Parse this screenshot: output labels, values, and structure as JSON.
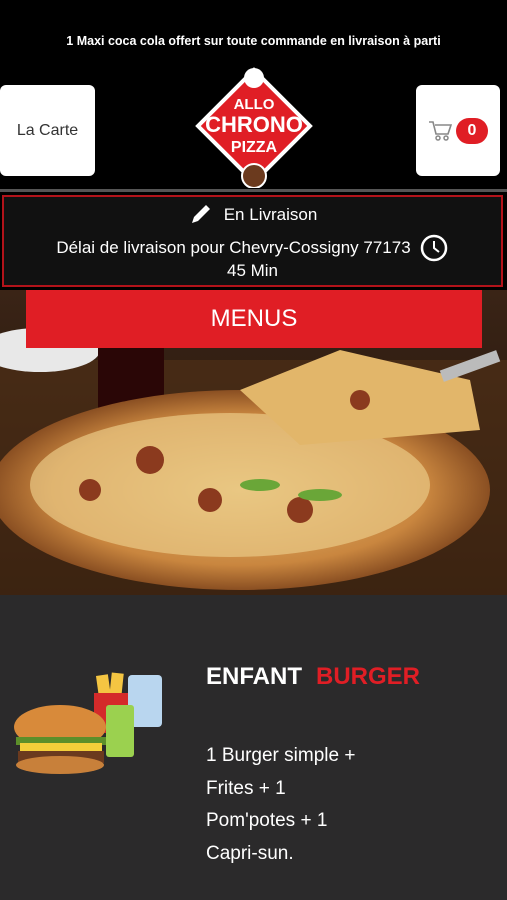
{
  "banner": "1 Maxi coca cola offert sur toute commande en livraison à parti",
  "header": {
    "carte_label": "La Carte",
    "cart_count": "0",
    "logo_line1": "ALLO",
    "logo_line2": "CHRONO",
    "logo_line3": "PIZZA"
  },
  "delivery": {
    "mode": "En Livraison",
    "delay_text": "Délai de livraison pour Chevry-Cossigny 77173",
    "duration": "45 Min"
  },
  "menu_button": "MENUS",
  "item": {
    "title_part1": "ENFANT",
    "title_part2": "BURGER",
    "lines": [
      "1 Burger simple  +",
      "Frites  + 1",
      "Pom'potes  + 1",
      "Capri-sun."
    ]
  },
  "colors": {
    "accent": "#e01e25",
    "background": "#000000",
    "content_bg": "#2b2a2b"
  }
}
